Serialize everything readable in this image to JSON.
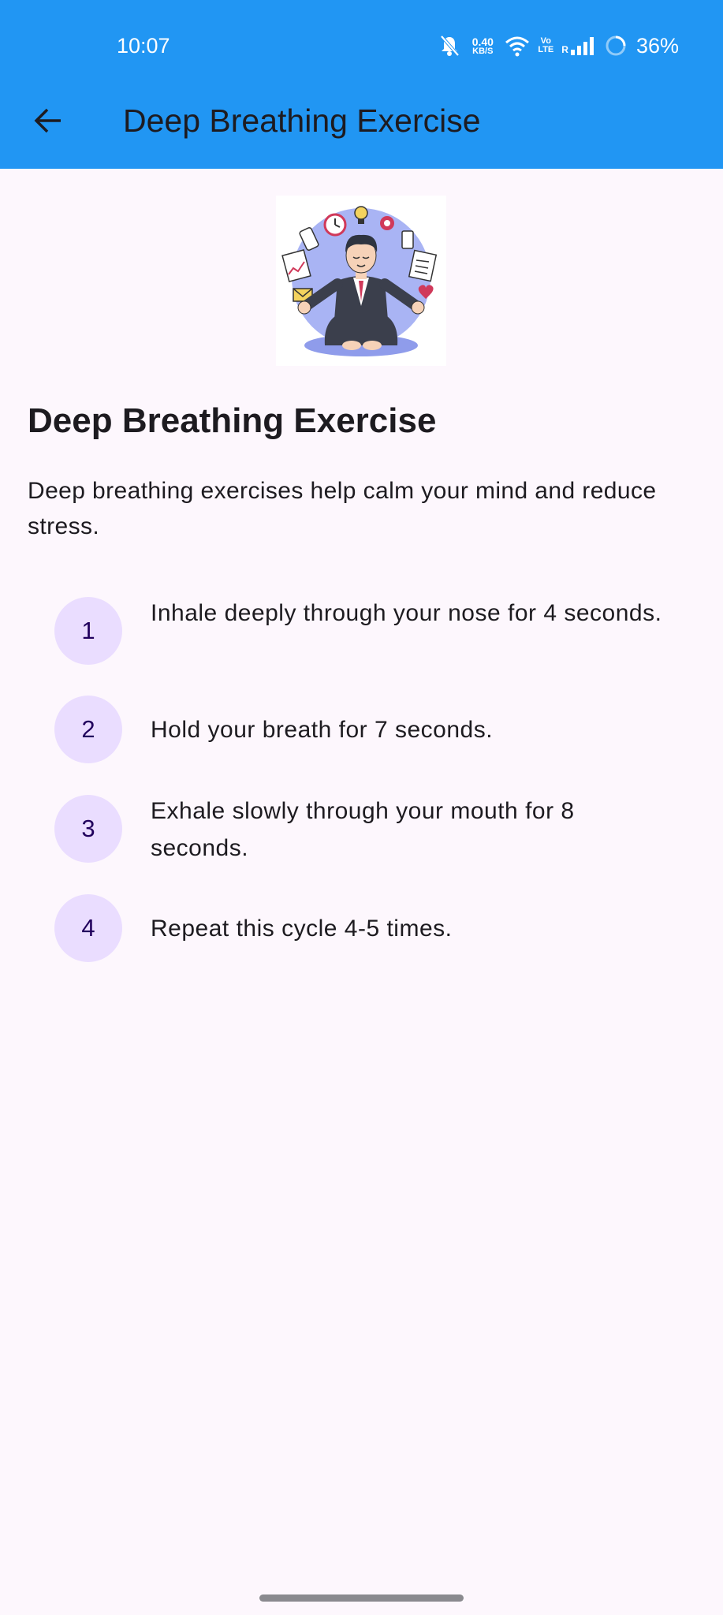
{
  "status_bar": {
    "time": "10:07",
    "net_speed": "0.40",
    "net_speed_unit": "KB/S",
    "volte_top": "Vo",
    "volte_bottom": "LTE",
    "roaming": "R",
    "battery": "36%",
    "icons": [
      "mute-icon",
      "wifi-icon",
      "signal-icon",
      "battery-icon"
    ]
  },
  "app_bar": {
    "back_icon": "arrow-left-icon",
    "title": "Deep Breathing Exercise",
    "background": "#2196F3"
  },
  "content": {
    "image": "meditating-businessman-illustration",
    "title": "Deep Breathing Exercise",
    "description": "Deep breathing exercises help calm your mind and reduce stress.",
    "steps": [
      {
        "number": "1",
        "text": "Inhale deeply through your nose for 4 seconds."
      },
      {
        "number": "2",
        "text": "Hold your breath for 7 seconds."
      },
      {
        "number": "3",
        "text": "Exhale slowly through your mouth for 8 seconds."
      },
      {
        "number": "4",
        "text": "Repeat this cycle 4-5 times."
      }
    ],
    "step_circle_color": "#EADDFF"
  }
}
